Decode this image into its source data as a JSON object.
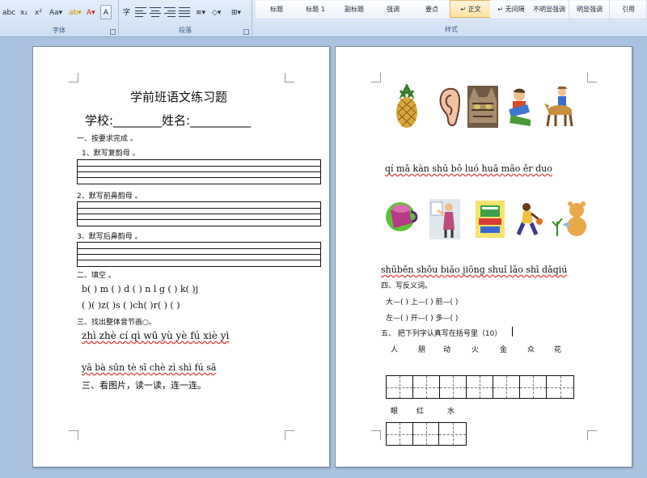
{
  "ribbon": {
    "font_group": {
      "label": "字体",
      "buttons": [
        "abc",
        "x₂",
        "x²",
        "Aa▾",
        "ab▾",
        "A▾",
        "A",
        "字"
      ]
    },
    "paragraph_group": {
      "label": "段落",
      "buttons": [
        "≡▾",
        "◇▾",
        "⊞▾"
      ]
    },
    "styles_group": {
      "label": "样式",
      "items": [
        "标题",
        "标题 1",
        "副标题",
        "强调",
        "要点",
        "↵ 正文",
        "↵ 无间隔",
        "不明显强调",
        "明显强调",
        "引用"
      ],
      "selected": "↵ 正文"
    }
  },
  "left_page": {
    "title": "学前班语文练习题",
    "school_line": "学校:________姓名:__________",
    "sec1": "一、按要求完成 。",
    "sec1_1": "1、默写复韵母 。",
    "sec1_2": "2、默写前鼻韵母 。",
    "sec1_3": "3、默写后鼻韵母 。",
    "sec2": "二、填空 。",
    "fill_row1": "b(    ) m (    ) d (    ) n l g (    ) k(    )j",
    "fill_row2": "(    )(    )z(    )s (    )ch(    )r(    ) (    )",
    "sec3": "三、找出整体音节画○。",
    "pinyin_row1": "zhì  zhè  cí  qì  wū  yù  yè  fú  xiè  yì",
    "pinyin_row2": "yā   bà  sūn  tè  sī  chè  zì  shì  fú  sā",
    "sec3b": "三、看图片，读一读，连一连。"
  },
  "right_page": {
    "pinyin_row1": "qí mǎ   kàn shū   bō  luó   huā  māo   ěr duo",
    "pinyin_row2": "shūběn  shǒu biǎo  jiōng shuǐ  lǎo shī  dǎqiú",
    "sec4": "四、写反义词。",
    "ant1": "大—(          )      上—(         )      前—(          )",
    "ant2": "左—(          )      开—(       ) 多—(          )",
    "sec5": "五、 把下列字认真写在括号里（10）",
    "chars1": [
      "人",
      "朋",
      "动",
      "火",
      "金",
      "众",
      "花"
    ],
    "chars2": [
      "眼",
      "红",
      "水"
    ]
  },
  "pictures": [
    "pineapple-icon",
    "ear-icon",
    "cat-icon",
    "reading-child-icon",
    "horse-rider-icon",
    "cup-icon",
    "teacher-icon",
    "books-icon",
    "basketball-player-icon",
    "watering-bear-icon"
  ],
  "colors": {
    "ribbon_bg": "#d6e4f5",
    "selected_style": "#ffe1a0",
    "workspace_bg": "#a9c2df",
    "spell_underline": "#e03030"
  }
}
